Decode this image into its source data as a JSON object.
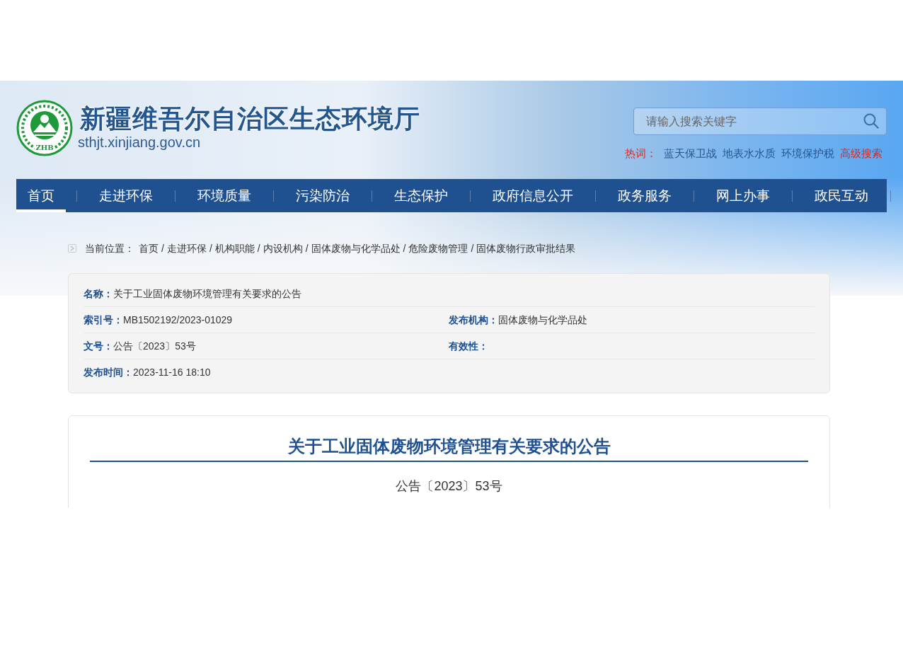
{
  "site": {
    "emblem_text": "ZHB",
    "title": "新疆维吾尔自治区生态环境厅",
    "url": "sthjt.xinjiang.gov.cn"
  },
  "search": {
    "placeholder": "请输入搜索关键字"
  },
  "hot_words": {
    "label": "热词：",
    "items": [
      "蓝天保卫战",
      "地表水水质",
      "环境保护税"
    ],
    "advanced": "高级搜索"
  },
  "nav": [
    {
      "label": "首页",
      "selected": true
    },
    {
      "label": "走进环保",
      "selected": false
    },
    {
      "label": "环境质量",
      "selected": false
    },
    {
      "label": "污染防治",
      "selected": false
    },
    {
      "label": "生态保护",
      "selected": false
    },
    {
      "label": "政府信息公开",
      "selected": false
    },
    {
      "label": "政务服务",
      "selected": false
    },
    {
      "label": "网上办事",
      "selected": false
    },
    {
      "label": "政民互动",
      "selected": false
    }
  ],
  "breadcrumb": {
    "label": "当前位置：",
    "separator": "/",
    "items": [
      "首页",
      "走进环保",
      "机构职能",
      "内设机构",
      "固体废物与化学品处",
      "危险废物管理",
      "固体废物行政审批结果"
    ]
  },
  "info": {
    "rows": [
      [
        {
          "label": "名称：",
          "value": "关于工业固体废物环境管理有关要求的公告"
        }
      ],
      [
        {
          "label": "索引号：",
          "value": "MB1502192/2023-01029"
        },
        {
          "label": "发布机构：",
          "value": "固体废物与化学品处"
        }
      ],
      [
        {
          "label": "文号：",
          "value": "公告〔2023〕53号"
        },
        {
          "label": "有效性："
        }
      ],
      [
        {
          "label": "发布时间：",
          "value": "2023-11-16 18:10"
        }
      ]
    ]
  },
  "article": {
    "title": "关于工业固体废物环境管理有关要求的公告",
    "doc_number": "公告〔2023〕53号"
  }
}
